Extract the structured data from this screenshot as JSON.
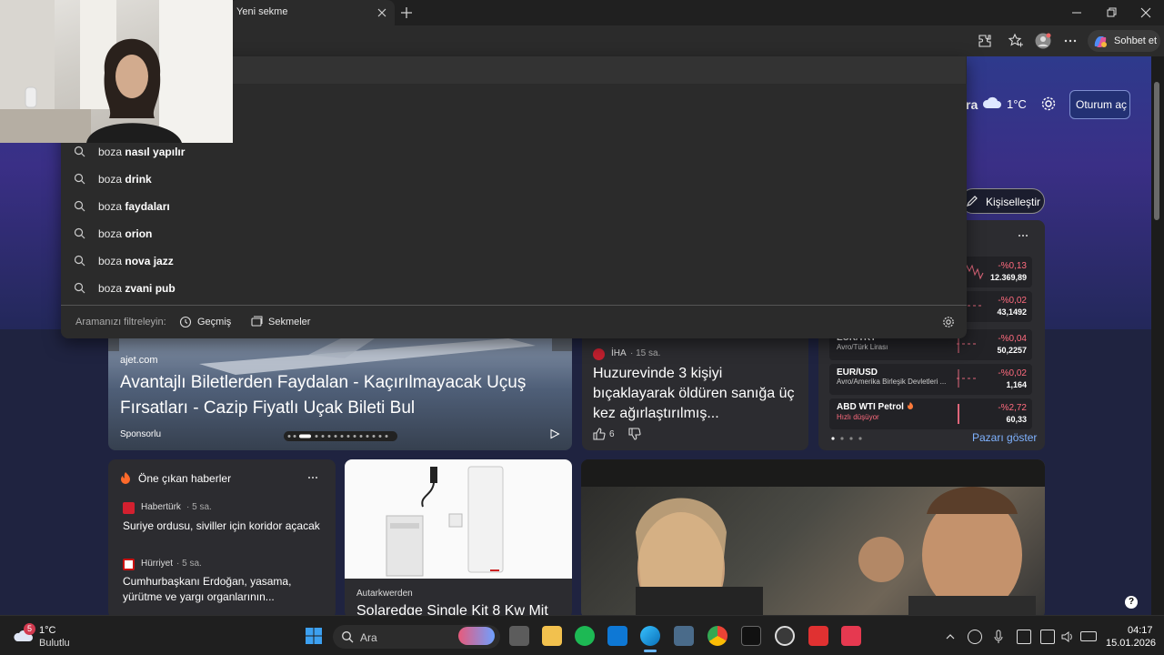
{
  "browser": {
    "tab_title": "Yeni sekme",
    "copilot_label": "Sohbet et"
  },
  "page": {
    "weather_city_suffix": "ra",
    "weather_temp": "1°C",
    "login_label": "Oturum aç",
    "personalize_label": "Kişiselleştir"
  },
  "search_dropdown": {
    "suggestions": [
      {
        "prefix": "boza",
        "completion": "nasıl yapılır"
      },
      {
        "prefix": "boza",
        "completion": "drink"
      },
      {
        "prefix": "boza",
        "completion": "faydaları"
      },
      {
        "prefix": "boza",
        "completion": "orion"
      },
      {
        "prefix": "boza",
        "completion": "nova jazz"
      },
      {
        "prefix": "boza",
        "completion": "zvani pub"
      }
    ],
    "filter_label": "Aramanızı filtreleyin:",
    "history_label": "Geçmiş",
    "tabs_label": "Sekmeler"
  },
  "hero_card": {
    "source": "ajet.com",
    "title": "Avantajlı Biletlerden Faydalan - Kaçırılmayacak Uçuş Fırsatları - Cazip Fiyatlı Uçak Bileti Bul",
    "sponsored": "Sponsorlu"
  },
  "news_card": {
    "source": "İHA",
    "time": "· 15 sa.",
    "title": "Huzurevinde 3 kişiyi bıçaklayarak öldüren sanığa üç kez ağırlaştırılmış...",
    "likes": "6"
  },
  "market": {
    "rows": [
      {
        "name": "",
        "sub": "",
        "change": "-%0,13",
        "value": "12.369,89"
      },
      {
        "name": "",
        "sub": "",
        "change": "-%0,02",
        "value": "43,1492"
      },
      {
        "name": "EUR/TRY",
        "sub": "Avro/Türk Lirası",
        "change": "-%0,04",
        "value": "50,2257"
      },
      {
        "name": "EUR/USD",
        "sub": "Avro/Amerika Birleşik Devletleri ...",
        "change": "-%0,02",
        "value": "1,164"
      },
      {
        "name": "ABD WTI Petrol",
        "sub": "Hızlı düşüyor",
        "change": "-%2,72",
        "value": "60,33"
      }
    ],
    "link_label": "Pazarı göster"
  },
  "top_news": {
    "header": "Öne çıkan haberler",
    "items": [
      {
        "source": "Habertürk",
        "time": "· 5 sa.",
        "title": "Suriye ordusu, siviller için koridor açacak"
      },
      {
        "source": "Hürriyet",
        "time": "· 5 sa.",
        "title": "Cumhurbaşkanı Erdoğan, yasama, yürütme ve yargı organlarının..."
      }
    ]
  },
  "product_card": {
    "source": "Autarkwerden",
    "title": "Solaredge Single Kit 8 Kw Mit"
  },
  "taskbar": {
    "weather_temp": "1°C",
    "weather_desc": "Bulutlu",
    "weather_badge": "5",
    "search_label": "Ara",
    "time": "04:17",
    "date": "15.01.2026"
  },
  "help_label": "?"
}
